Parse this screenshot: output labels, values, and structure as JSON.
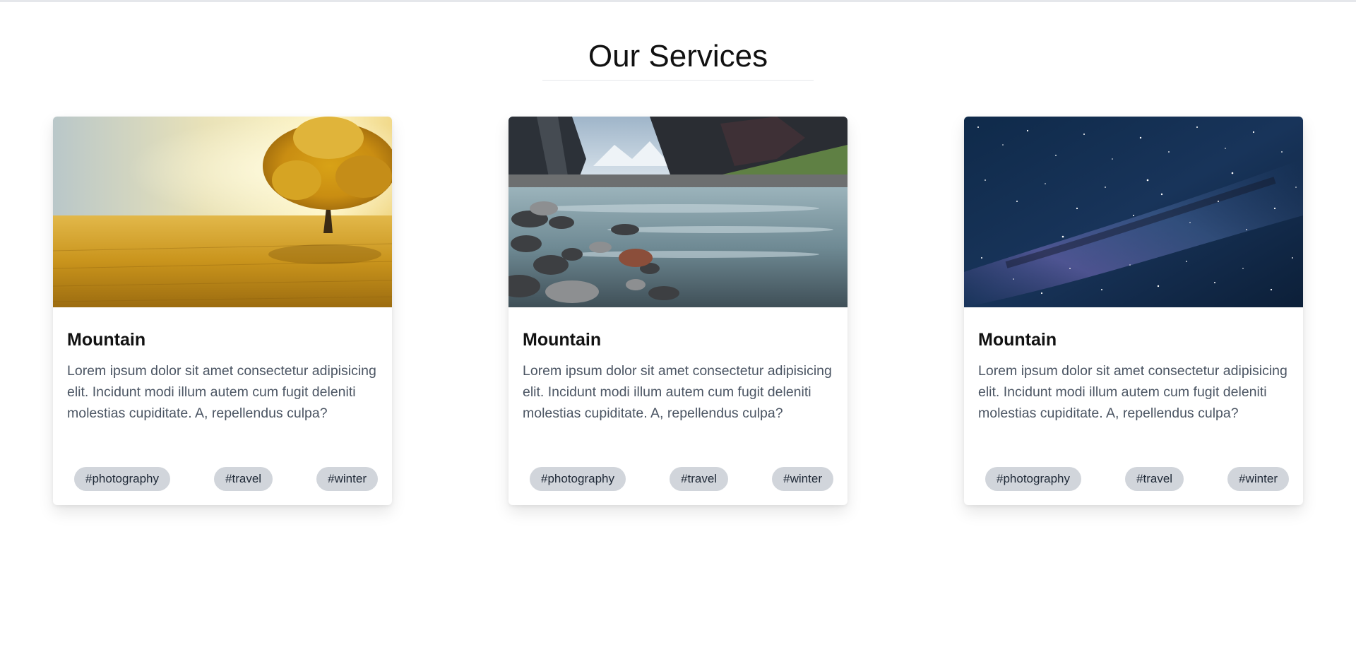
{
  "section": {
    "title": "Our Services"
  },
  "cards": [
    {
      "image": "golden-field-tree",
      "title": "Mountain",
      "text": "Lorem ipsum dolor sit amet consectetur adipisicing elit. Incidunt modi illum autem cum fugit deleniti molestias cupiditate. A, repellendus culpa?",
      "tags": [
        "#photography",
        "#travel",
        "#winter"
      ]
    },
    {
      "image": "mountain-river",
      "title": "Mountain",
      "text": "Lorem ipsum dolor sit amet consectetur adipisicing elit. Incidunt modi illum autem cum fugit deleniti molestias cupiditate. A, repellendus culpa?",
      "tags": [
        "#photography",
        "#travel",
        "#winter"
      ]
    },
    {
      "image": "starry-night-sky",
      "title": "Mountain",
      "text": "Lorem ipsum dolor sit amet consectetur adipisicing elit. Incidunt modi illum autem cum fugit deleniti molestias cupiditate. A, repellendus culpa?",
      "tags": [
        "#photography",
        "#travel",
        "#winter"
      ]
    }
  ],
  "colors": {
    "tag_background": "#d1d5db",
    "body_text": "#4b5563",
    "divider": "#e5e7eb"
  }
}
